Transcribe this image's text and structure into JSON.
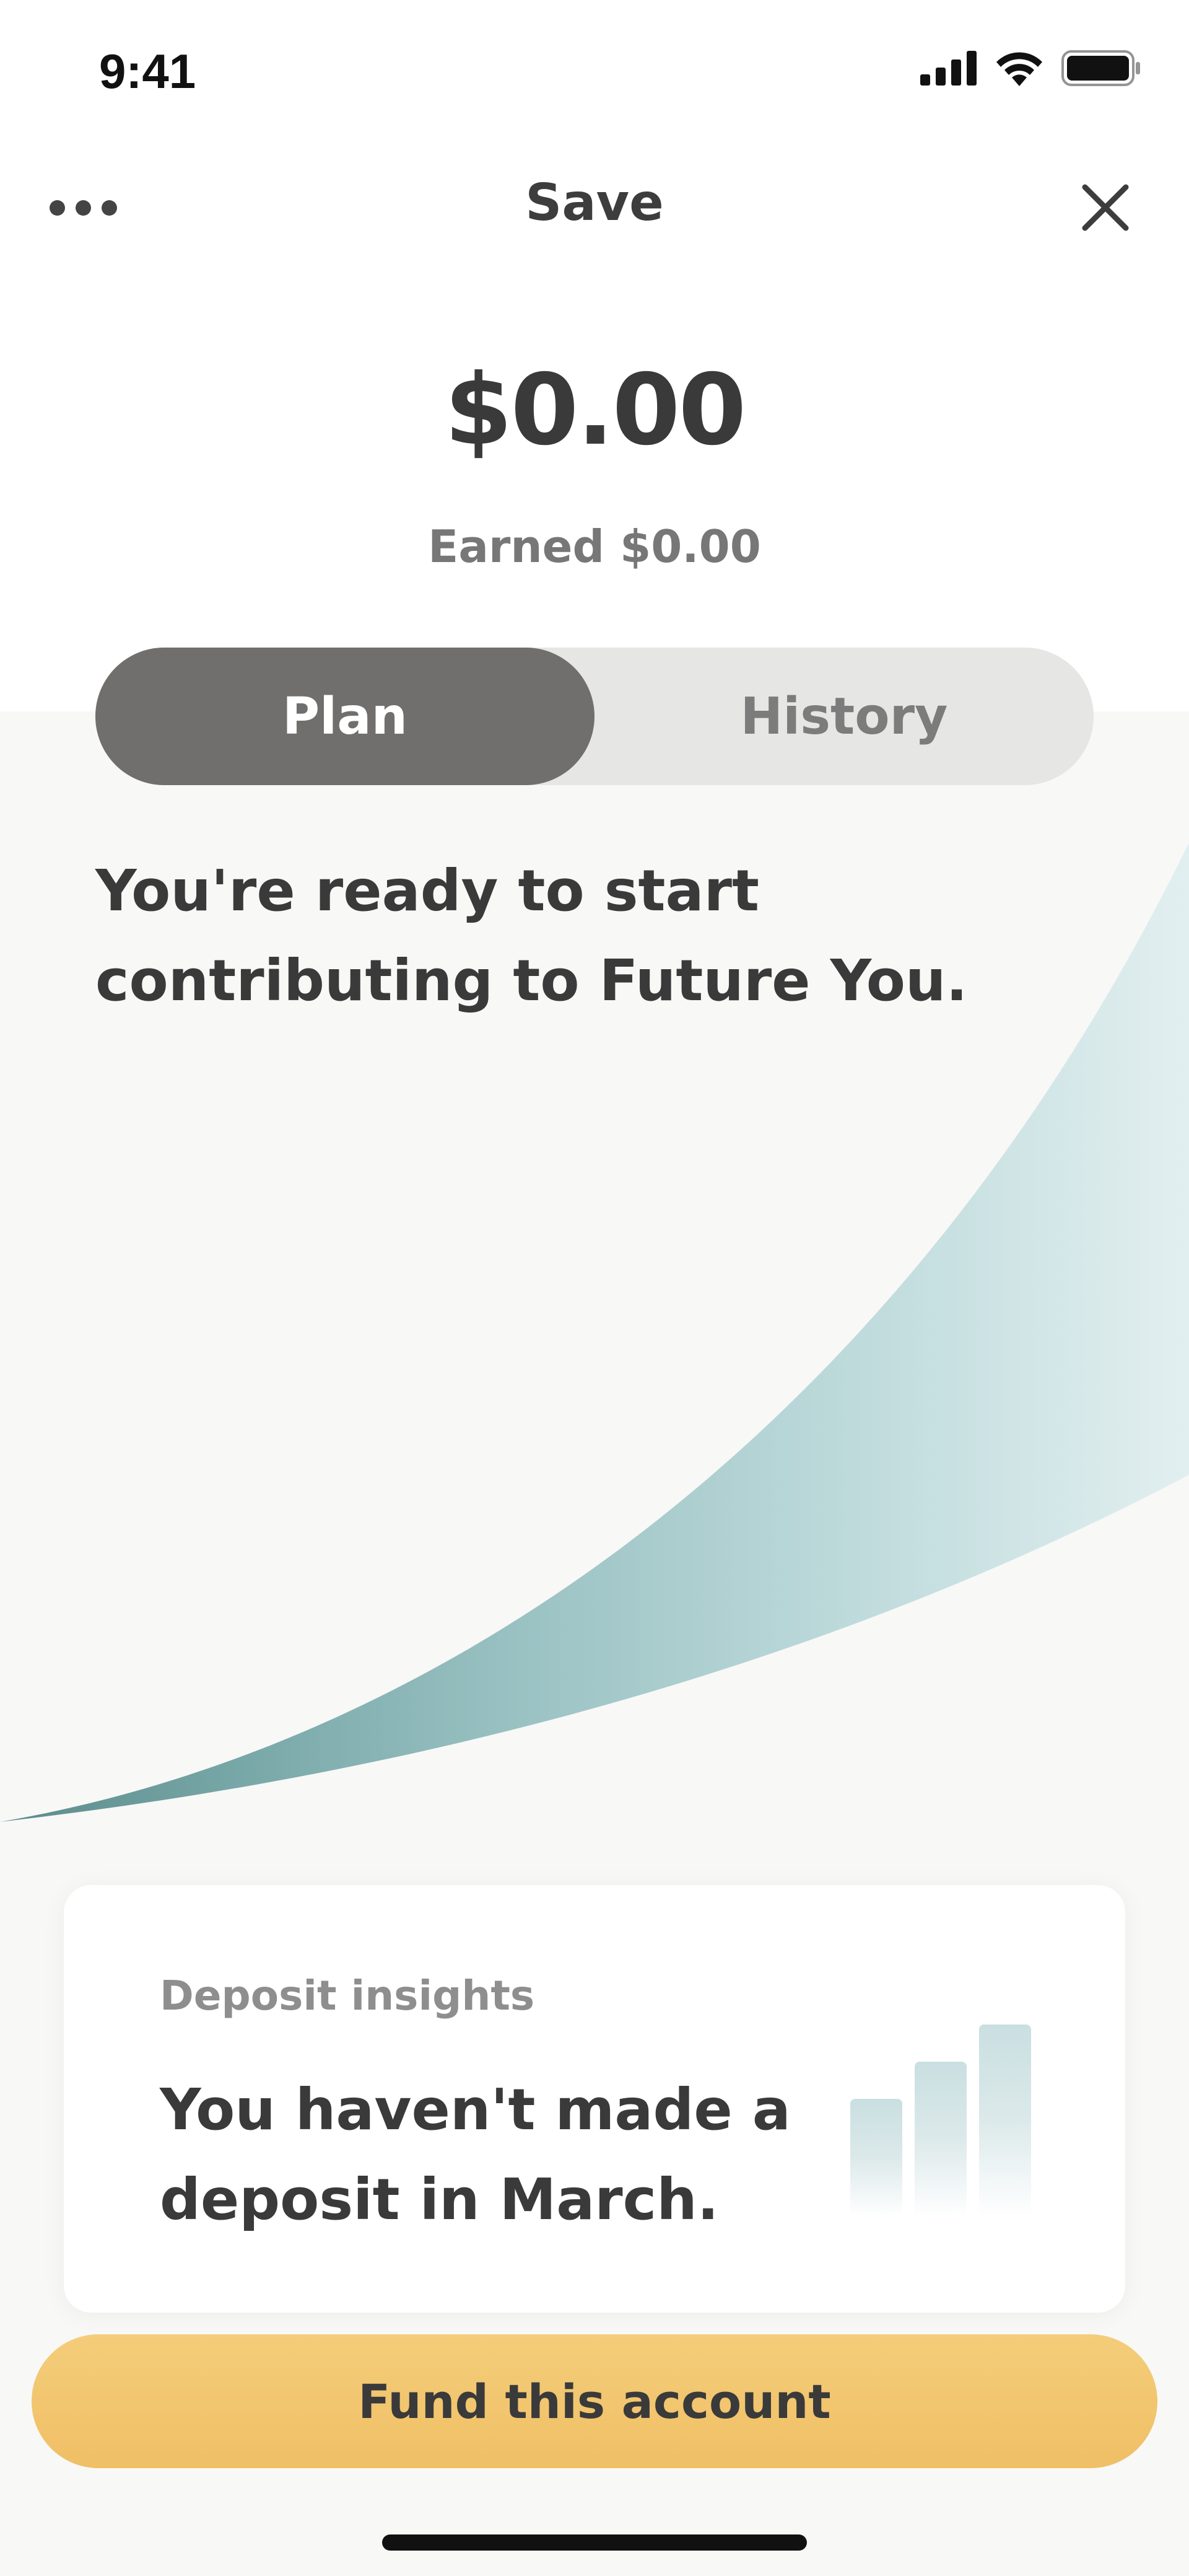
{
  "status_bar": {
    "time": "9:41"
  },
  "nav": {
    "title": "Save",
    "more_icon": "more-dots-icon",
    "close_icon": "close-icon"
  },
  "account": {
    "balance": "$0.00",
    "earned": "Earned $0.00"
  },
  "tabs": [
    {
      "label": "Plan",
      "selected": true
    },
    {
      "label": "History",
      "selected": false
    }
  ],
  "headline": "You're ready to start contributing to Future You.",
  "insight": {
    "label": "Deposit insights",
    "text": "You haven't made a deposit in March.",
    "icon": "bar-chart-icon"
  },
  "fund_button": {
    "label": "Fund this account"
  },
  "colors": {
    "active_tab": "#706f6d",
    "tab_track": "#e6e6e4",
    "curve_dark": "#5f8e8e",
    "curve_light": "#d9ebec",
    "fund_button": "#f2c26a"
  }
}
